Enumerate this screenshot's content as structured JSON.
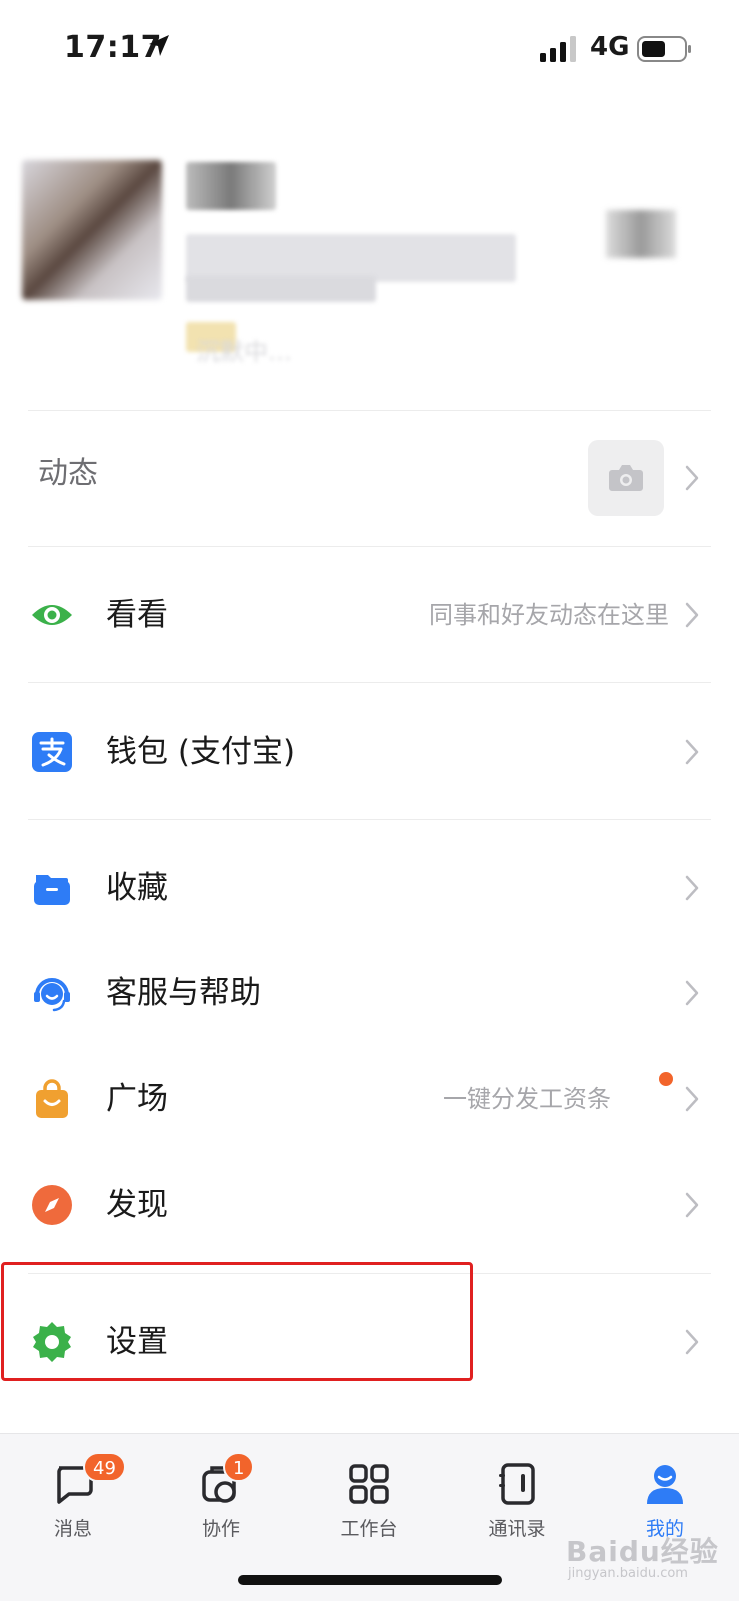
{
  "status_bar": {
    "time": "17:17",
    "network": "4G"
  },
  "profile": {
    "status_text": "沉默中…"
  },
  "dynamics": {
    "label": "动态"
  },
  "menu": {
    "kankan": {
      "label": "看看",
      "hint": "同事和好友动态在这里"
    },
    "wallet": {
      "label": "钱包 (支付宝)"
    },
    "favorites": {
      "label": "收藏"
    },
    "support": {
      "label": "客服与帮助"
    },
    "square": {
      "label": "广场",
      "hint": "一键分发工资条"
    },
    "discover": {
      "label": "发现"
    },
    "settings": {
      "label": "设置"
    }
  },
  "tabs": [
    {
      "label": "消息",
      "badge": "49"
    },
    {
      "label": "协作",
      "badge": "1"
    },
    {
      "label": "工作台"
    },
    {
      "label": "通讯录"
    },
    {
      "label": "我的",
      "active": true
    }
  ],
  "watermark": {
    "brand": "Baidu经验",
    "url": "jingyan.baidu.com"
  },
  "colors": {
    "accent": "#2e7cf6",
    "badge": "#f2642b",
    "highlight": "#e02020",
    "green": "#3bb14a",
    "orange": "#f0a030"
  }
}
